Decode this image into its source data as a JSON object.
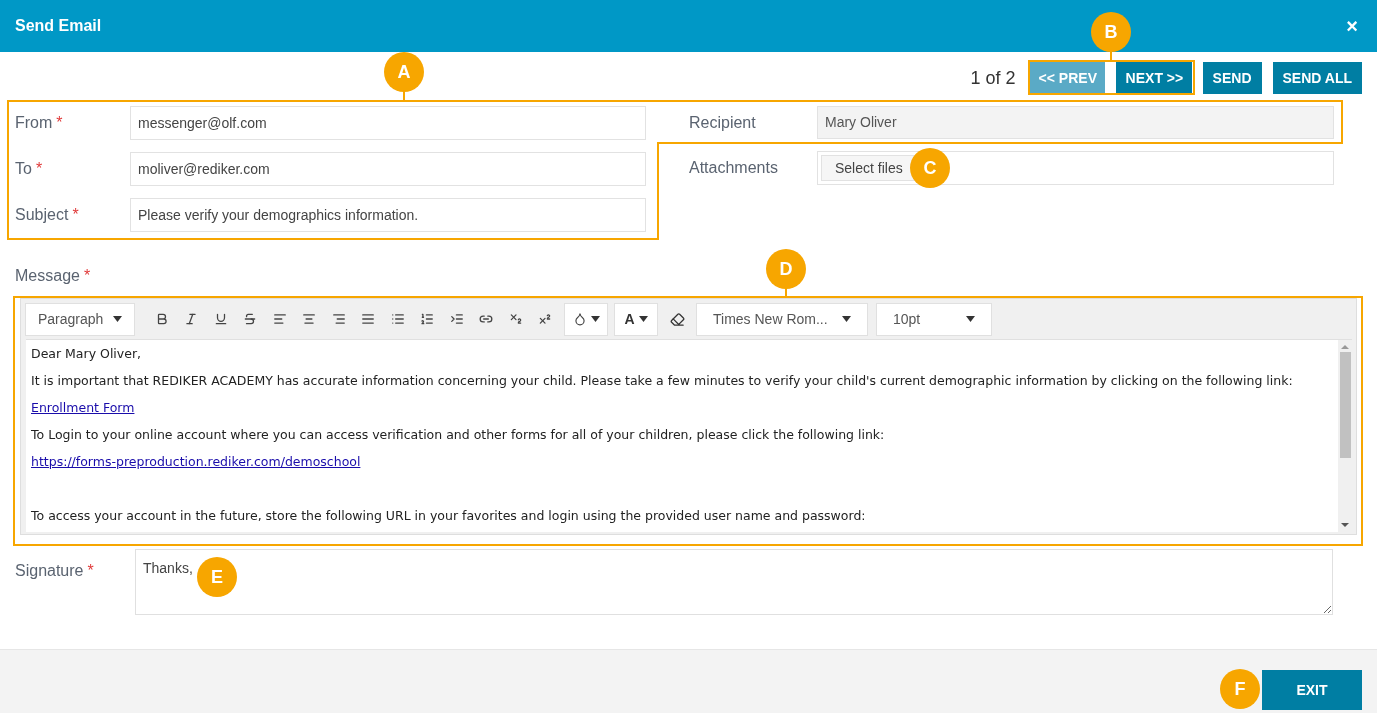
{
  "window": {
    "title": "Send Email",
    "close": "×"
  },
  "pager": {
    "position": "1 of 2",
    "buttons": [
      {
        "label": "<< PREV",
        "kind": "prev"
      },
      {
        "label": "NEXT >>",
        "kind": "next"
      },
      {
        "label": "SEND",
        "kind": "send"
      },
      {
        "label": "SEND ALL",
        "kind": "send"
      }
    ]
  },
  "left_fields": [
    {
      "label": "From",
      "mark": "*",
      "value": "messenger@olf.com"
    },
    {
      "label": "To",
      "mark": "*",
      "value": "moliver@rediker.com"
    },
    {
      "label": "Subject",
      "mark": "*",
      "value": "Please verify your demographics information."
    }
  ],
  "recipient": {
    "label": "Recipient",
    "value": "Mary Oliver",
    "disabled": true
  },
  "attachments": {
    "label": "Attachments",
    "button": "Select files"
  },
  "message": {
    "label": "Message",
    "mark": "*",
    "toolbar": {
      "block_format": "Paragraph",
      "text_color": "A",
      "font": "Times New Rom...",
      "size": "10pt"
    },
    "paragraphs": [
      {
        "kind": "text",
        "text": "Dear Mary Oliver,"
      },
      {
        "kind": "text",
        "text": "It is important that REDIKER ACADEMY has accurate information concerning your child. Please take a few minutes to verify your child's current demographic information by clicking on the following link:"
      },
      {
        "kind": "link",
        "text": "Enrollment Form"
      },
      {
        "kind": "text",
        "text": "To Login to your online account where you can access verification and other forms for all of your children, please click the following link:"
      },
      {
        "kind": "link",
        "text": "https://forms-preproduction.rediker.com/demoschool"
      },
      {
        "kind": "blank"
      },
      {
        "kind": "text",
        "text": "To access your account in the future, store the following URL in your favorites and login using the provided user name and password:"
      }
    ]
  },
  "signature": {
    "label": "Signature",
    "mark": "*",
    "value": "Thanks,"
  },
  "footer": {
    "exit": "EXIT"
  },
  "callouts": [
    {
      "letter": "A"
    },
    {
      "letter": "B"
    },
    {
      "letter": "C"
    },
    {
      "letter": "D"
    },
    {
      "letter": "E"
    },
    {
      "letter": "F"
    }
  ]
}
